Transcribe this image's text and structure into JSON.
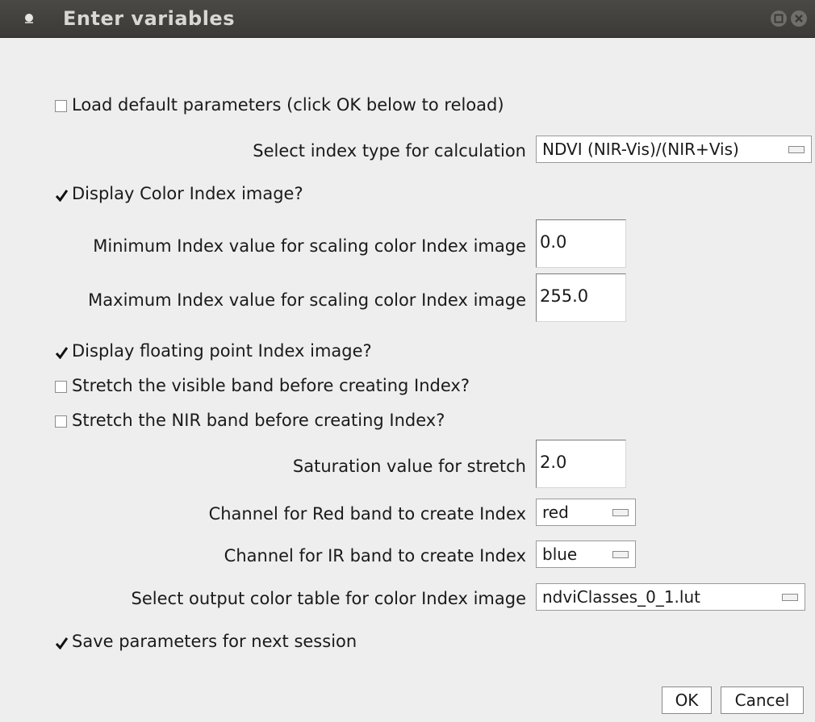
{
  "window": {
    "title": "Enter variables"
  },
  "fields": {
    "load_default": {
      "label": "Load default parameters (click OK below to reload)",
      "checked": false
    },
    "index_type": {
      "label": "Select index type for calculation",
      "value": "NDVI (NIR-Vis)/(NIR+Vis)"
    },
    "display_color": {
      "label": "Display Color Index image?",
      "checked": true
    },
    "min_index": {
      "label": "Minimum Index value for scaling color Index image",
      "value": "0.0"
    },
    "max_index": {
      "label": "Maximum Index value for scaling color Index image",
      "value": "255.0"
    },
    "display_float": {
      "label": "Display floating point Index image?",
      "checked": true
    },
    "stretch_visible": {
      "label": "Stretch the visible band before creating Index?",
      "checked": false
    },
    "stretch_nir": {
      "label": "Stretch the NIR band before creating Index?",
      "checked": false
    },
    "saturation": {
      "label": "Saturation value for stretch",
      "value": "2.0"
    },
    "red_channel": {
      "label": "Channel for Red band to create Index",
      "value": "red"
    },
    "ir_channel": {
      "label": "Channel for IR band to create Index",
      "value": "blue"
    },
    "color_table": {
      "label": "Select output color table for color Index image",
      "value": "ndviClasses_0_1.lut"
    },
    "save_params": {
      "label": "Save parameters for next session",
      "checked": true
    }
  },
  "buttons": {
    "ok": "OK",
    "cancel": "Cancel"
  },
  "colors": {
    "titlebar": "#3b3a37",
    "dialog_bg": "#eeeeee",
    "title_text": "#d9d7d2"
  }
}
